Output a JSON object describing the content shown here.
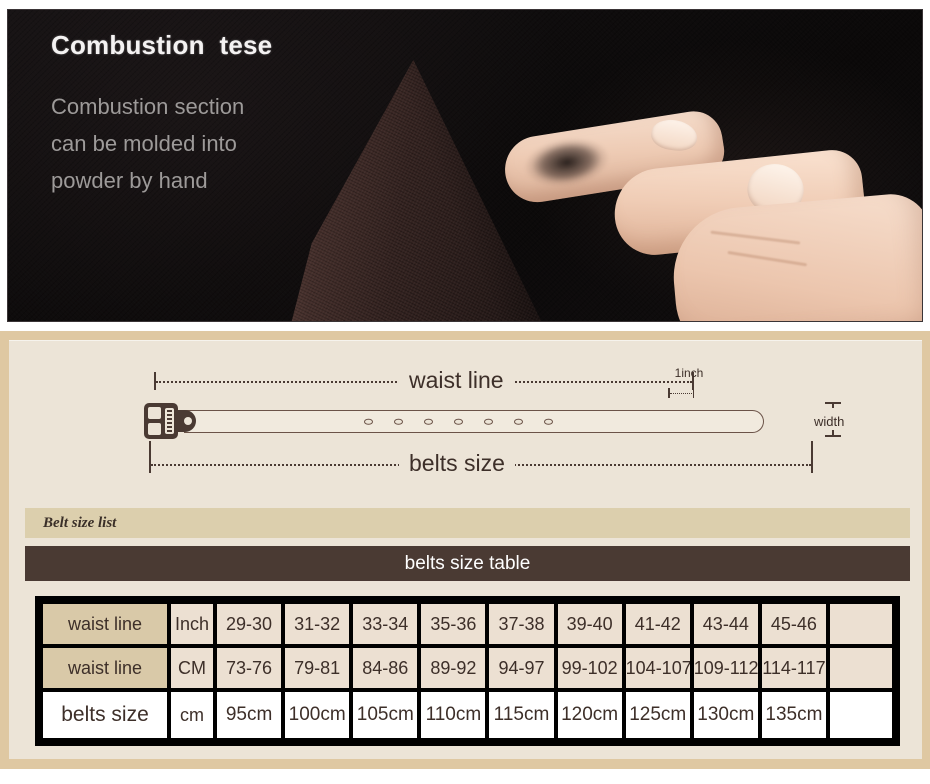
{
  "photo": {
    "headline": "Combustion  tese",
    "subtext": "Combustion section\ncan be molded into\npowder by hand"
  },
  "diagram": {
    "waist_line_label": "waist line",
    "belts_size_label": "belts size",
    "inch_label": "1inch",
    "width_label": "width",
    "hole_count": 7
  },
  "list_bar": {
    "title": "Belt size list"
  },
  "table_header": {
    "title": "belts size table"
  },
  "table": {
    "rows": [
      {
        "label": "waist line",
        "unit": "Inch",
        "values": [
          "29-30",
          "31-32",
          "33-34",
          "35-36",
          "37-38",
          "39-40",
          "41-42",
          "43-44",
          "45-46"
        ]
      },
      {
        "label": "waist line",
        "unit": "CM",
        "values": [
          "73-76",
          "79-81",
          "84-86",
          "89-92",
          "94-97",
          "99-102",
          "104-107",
          "109-112",
          "114-117"
        ]
      },
      {
        "label": "belts size",
        "unit": "cm",
        "values": [
          "95cm",
          "100cm",
          "105cm",
          "110cm",
          "115cm",
          "120cm",
          "125cm",
          "130cm",
          "135cm"
        ]
      }
    ]
  },
  "colors": {
    "panel_border": "#dfc8a2",
    "panel_bg": "#ece4d7",
    "dark_brown": "#4a3a33",
    "label_tan": "#d9c9a8",
    "cell_beige": "#ece0d2",
    "list_bar": "#dccfad",
    "photo_bg": "#0d0b0c"
  }
}
